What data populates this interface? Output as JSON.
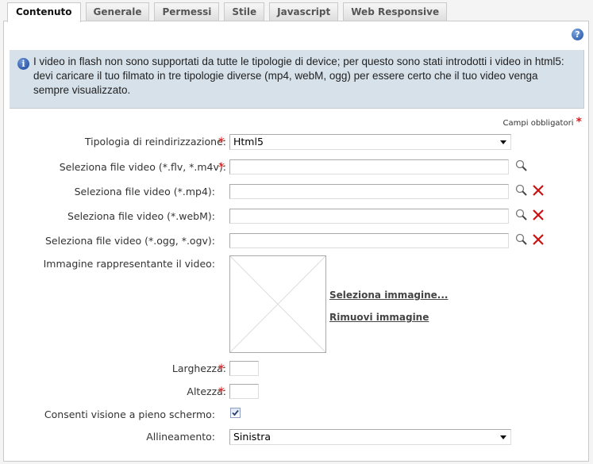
{
  "tabs": [
    {
      "label": "Contenuto",
      "active": true
    },
    {
      "label": "Generale",
      "active": false
    },
    {
      "label": "Permessi",
      "active": false
    },
    {
      "label": "Stile",
      "active": false
    },
    {
      "label": "Javascript",
      "active": false
    },
    {
      "label": "Web Responsive",
      "active": false
    }
  ],
  "help_icon": "question-circle-icon",
  "info": {
    "icon": "info-circle-icon",
    "text": "I video in flash non sono supportati da tutte le tipologie di device; per questo sono stati introdotti i video in html5: devi caricare il tuo filmato in tre tipologie diverse (mp4, webM, ogg) per essere certo che il tuo video venga sempre visualizzato."
  },
  "required_note": "Campi obbligatori",
  "required_mark": "*",
  "form": {
    "redirect_type": {
      "label": "Tipologia di reindirizzazione:",
      "value": "Html5",
      "required": true
    },
    "file_flv": {
      "label": "Seleziona file video (*.flv, *.m4v):",
      "value": "",
      "required": true
    },
    "file_mp4": {
      "label": "Seleziona file video (*.mp4):",
      "value": "",
      "required": false
    },
    "file_webm": {
      "label": "Seleziona file video (*.webM):",
      "value": "",
      "required": false
    },
    "file_ogg": {
      "label": "Seleziona file video (*.ogg, *.ogv):",
      "value": "",
      "required": false
    },
    "image": {
      "label": "Immagine rappresentante il video:",
      "select_link": "Seleziona immagine...",
      "remove_link": "Rimuovi immagine"
    },
    "width": {
      "label": "Larghezza:",
      "value": "",
      "required": true
    },
    "height": {
      "label": "Altezza:",
      "value": "",
      "required": true
    },
    "fullscreen": {
      "label": "Consenti visione a pieno schermo:",
      "checked": true
    },
    "alignment": {
      "label": "Allineamento:",
      "value": "Sinistra"
    }
  },
  "colors": {
    "info_bg": "#d6e1ea",
    "required_red": "#e01818",
    "delete_red": "#cc1111"
  }
}
